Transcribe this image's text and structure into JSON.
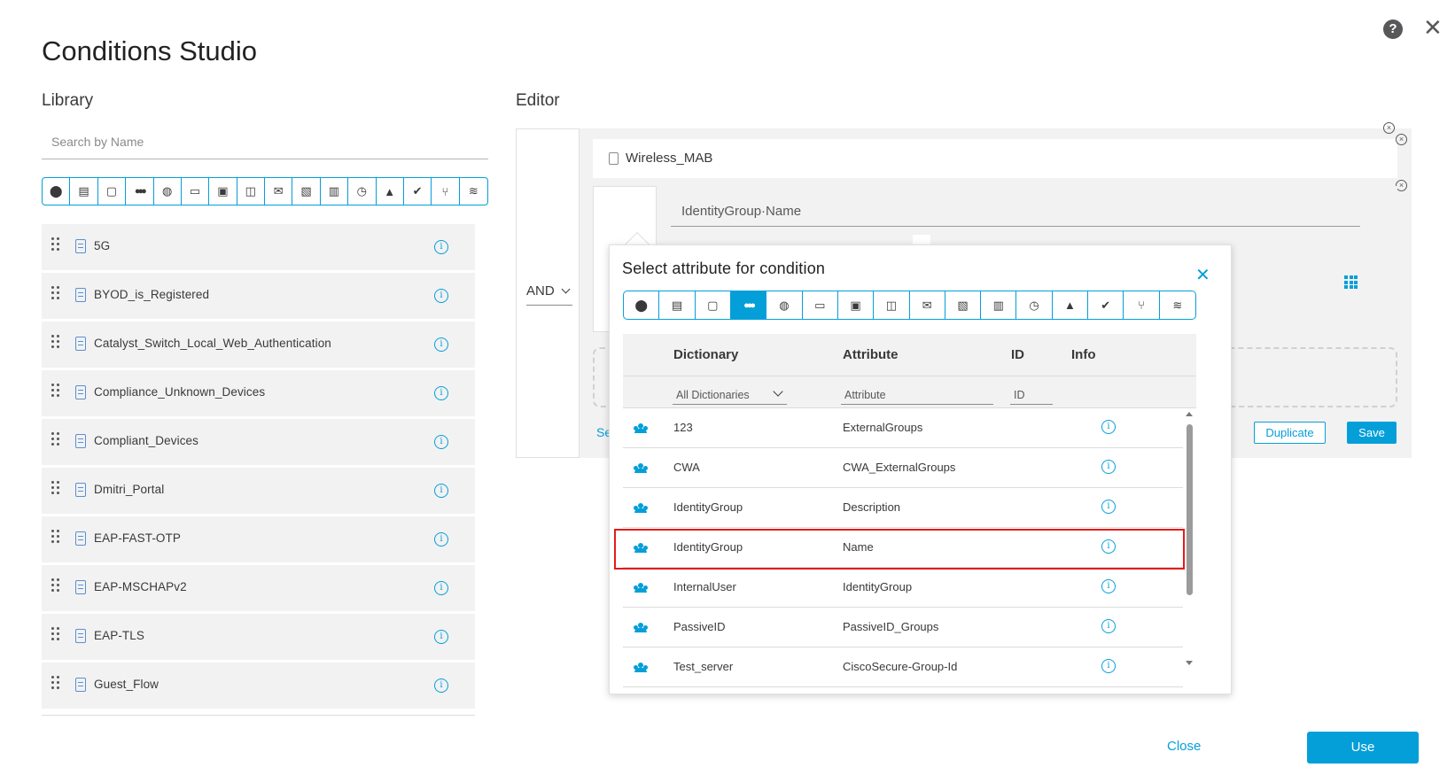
{
  "header": {
    "title": "Conditions Studio",
    "help_glyph": "?",
    "close_glyph": "✕"
  },
  "library": {
    "label": "Library",
    "search_placeholder": "Search by Name",
    "icon_filters": [
      "location-icon",
      "card-icon",
      "square-icon",
      "users-icon",
      "globe-icon",
      "desktop-icon",
      "monitor-icon",
      "network-icon",
      "mail-icon",
      "document-icon",
      "server-icon",
      "clock-icon",
      "person-icon",
      "check-circle-icon",
      "tree-icon",
      "wifi-icon"
    ],
    "items": [
      {
        "label": "5G"
      },
      {
        "label": "BYOD_is_Registered"
      },
      {
        "label": "Catalyst_Switch_Local_Web_Authentication"
      },
      {
        "label": "Compliance_Unknown_Devices"
      },
      {
        "label": "Compliant_Devices"
      },
      {
        "label": "Dmitri_Portal"
      },
      {
        "label": "EAP-FAST-OTP"
      },
      {
        "label": "EAP-MSCHAPv2"
      },
      {
        "label": "EAP-TLS"
      },
      {
        "label": "Guest_Flow"
      }
    ]
  },
  "editor": {
    "label": "Editor",
    "operator": "AND",
    "condition_name": "Wireless_MAB",
    "attribute_value": "IdentityGroup·Name",
    "partial_link": "Se",
    "duplicate_label": "Duplicate",
    "save_label": "Save"
  },
  "popup": {
    "title": "Select attribute for condition",
    "active_filter_index": 3,
    "columns": {
      "dictionary": "Dictionary",
      "attribute": "Attribute",
      "id": "ID",
      "info": "Info"
    },
    "filters": {
      "dictionary": "All Dictionaries",
      "attribute_placeholder": "Attribute",
      "id_placeholder": "ID"
    },
    "rows": [
      {
        "dictionary": "123",
        "attribute": "ExternalGroups"
      },
      {
        "dictionary": "CWA",
        "attribute": "CWA_ExternalGroups"
      },
      {
        "dictionary": "IdentityGroup",
        "attribute": "Description"
      },
      {
        "dictionary": "IdentityGroup",
        "attribute": "Name",
        "highlighted": true
      },
      {
        "dictionary": "InternalUser",
        "attribute": "IdentityGroup"
      },
      {
        "dictionary": "PassiveID",
        "attribute": "PassiveID_Groups"
      },
      {
        "dictionary": "Test_server",
        "attribute": "CiscoSecure-Group-Id"
      }
    ]
  },
  "footer": {
    "close_label": "Close",
    "use_label": "Use"
  },
  "colors": {
    "accent": "#049fd9",
    "highlight": "#e31b1b",
    "panel": "#f2f2f2"
  }
}
